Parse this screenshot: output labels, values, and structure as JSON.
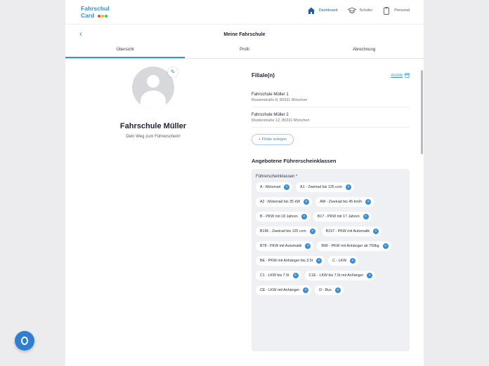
{
  "logo": {
    "line1": "Fahrschul",
    "line2": "Card",
    "dot_colors": [
      "#e74c3c",
      "#f5b700",
      "#2ecc71"
    ]
  },
  "nav": [
    {
      "label": "Dashboard",
      "icon": "home-icon",
      "active": true
    },
    {
      "label": "Schüler",
      "icon": "graduation-cap-icon",
      "active": false
    },
    {
      "label": "Personal",
      "icon": "clipboard-icon",
      "active": false
    }
  ],
  "header": {
    "back": "‹",
    "title": "Meine Fahrschule"
  },
  "tabs": [
    "Übersicht",
    "Profil",
    "Abrechnung"
  ],
  "profile": {
    "name": "Fahrschule Müller",
    "tagline": "Dein Weg zum Führerschein!",
    "edit_icon": "✎"
  },
  "branches": {
    "title": "Filiale(n)",
    "archive": "Archiv",
    "items": [
      {
        "name": "Fahrschule Müller 1",
        "address": "Musterstraße 8, 80331 München"
      },
      {
        "name": "Fahrschule Müller 2",
        "address": "Musterstraße 12, 80331 München"
      }
    ],
    "add_button": "Filiale anlegen"
  },
  "classes": {
    "title": "Angebotene Führerscheinklassen",
    "field_label": "Führerscheinklassen *",
    "chips": [
      "A - Motorrad",
      "A1 - Zweirad bis 125 ccm",
      "A2 - Motorrad bis 35 kW",
      "AM - Zweirad bis 45 km/h",
      "B - PKW mit 18 Jahren",
      "B17 - PKW mit 17 Jahren",
      "B196 - Zweirad bis 125 ccm",
      "B197 - PKW mit Automatik",
      "B78 - PKW mit Automatik",
      "B96 - PKW mit Anhänger ab 750kg",
      "BE - PKW mit Anhänger bis 3.5t",
      "C - LKW",
      "C1 - LKW bis 7.5t",
      "C1E - LKW bis 7.5t mit Anhänger",
      "CE - LKW mit Anhänger",
      "D - Bus"
    ]
  },
  "colors": {
    "accent": "#3a8fd6",
    "fab": "#2f7fd0"
  }
}
